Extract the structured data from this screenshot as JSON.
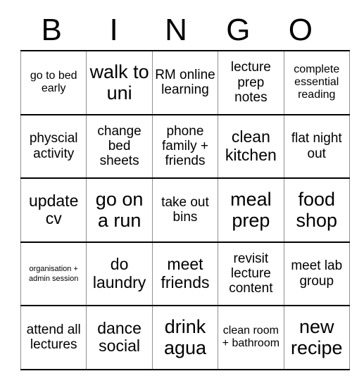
{
  "card": {
    "title": "BINGO",
    "header_letters": [
      "B",
      "I",
      "N",
      "G",
      "O"
    ],
    "rows": [
      [
        {
          "text": "go to bed early",
          "size": "sm"
        },
        {
          "text": "walk to uni",
          "size": "xl"
        },
        {
          "text": "RM online learning",
          "size": "md"
        },
        {
          "text": "lecture prep notes",
          "size": "md"
        },
        {
          "text": "complete essential reading",
          "size": "sm"
        }
      ],
      [
        {
          "text": "physcial activity",
          "size": "md"
        },
        {
          "text": "change bed sheets",
          "size": "md"
        },
        {
          "text": "phone family + friends",
          "size": "md"
        },
        {
          "text": "clean kitchen",
          "size": "lg"
        },
        {
          "text": "flat night out",
          "size": "md"
        }
      ],
      [
        {
          "text": "update cv",
          "size": "lg"
        },
        {
          "text": "go on a run",
          "size": "xl"
        },
        {
          "text": "take out bins",
          "size": "md"
        },
        {
          "text": "meal prep",
          "size": "xl"
        },
        {
          "text": "food shop",
          "size": "xl"
        }
      ],
      [
        {
          "text": "organisation + admin session",
          "size": "xs"
        },
        {
          "text": "do laundry",
          "size": "lg"
        },
        {
          "text": "meet friends",
          "size": "lg"
        },
        {
          "text": "revisit lecture content",
          "size": "md"
        },
        {
          "text": "meet lab group",
          "size": "md"
        }
      ],
      [
        {
          "text": "attend all lectures",
          "size": "md"
        },
        {
          "text": "dance social",
          "size": "lg"
        },
        {
          "text": "drink agua",
          "size": "xl"
        },
        {
          "text": "clean room + bathroom",
          "size": "sm"
        },
        {
          "text": "new recipe",
          "size": "xl"
        }
      ]
    ]
  },
  "colors": {
    "background": "#ffffff",
    "text": "#000000",
    "grid_line_horizontal": "#000000",
    "grid_line_vertical": "#909090"
  }
}
